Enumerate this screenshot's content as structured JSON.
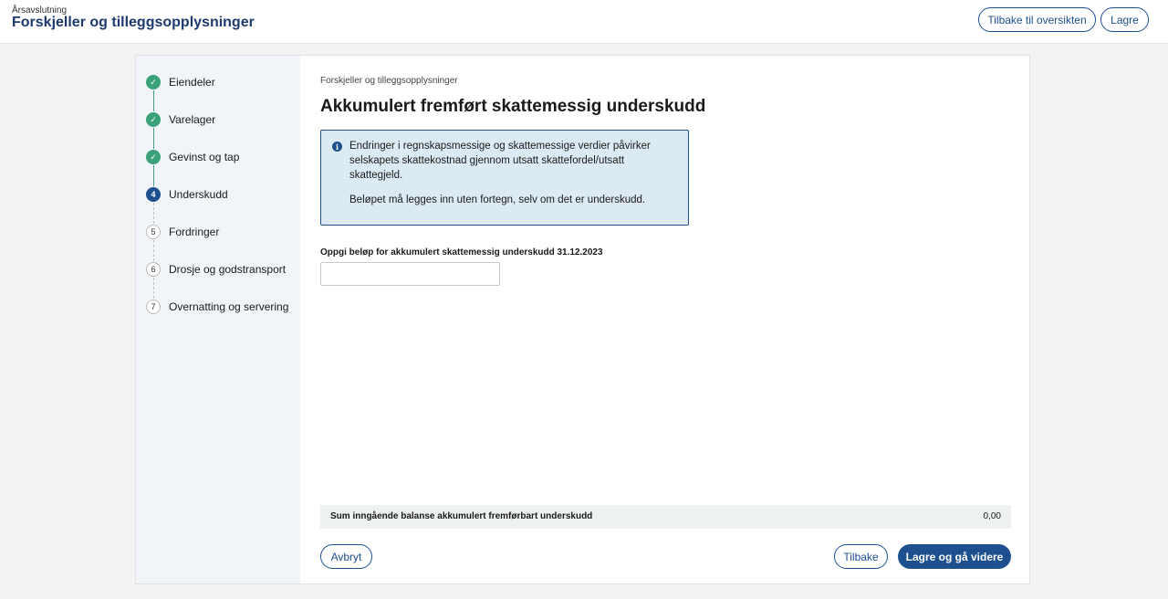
{
  "header": {
    "breadcrumb": "Årsavslutning",
    "title": "Forskjeller og tilleggsopplysninger",
    "back_to_overview_label": "Tilbake til oversikten",
    "save_label": "Lagre"
  },
  "steps": [
    {
      "number": "1",
      "label": "Eiendeler",
      "status": "done"
    },
    {
      "number": "2",
      "label": "Varelager",
      "status": "done"
    },
    {
      "number": "3",
      "label": "Gevinst og tap",
      "status": "done"
    },
    {
      "number": "4",
      "label": "Underskudd",
      "status": "active"
    },
    {
      "number": "5",
      "label": "Fordringer",
      "status": "todo"
    },
    {
      "number": "6",
      "label": "Drosje og godstransport",
      "status": "todo"
    },
    {
      "number": "7",
      "label": "Overnatting og servering",
      "status": "todo"
    }
  ],
  "main": {
    "breadcrumb": "Forskjeller og tilleggsopplysninger",
    "title": "Akkumulert fremført skattemessig underskudd",
    "info": {
      "icon": "info-icon",
      "paragraph1": "Endringer i regnskapsmessige og skattemessige verdier påvirker selskapets skattekostnad gjennom utsatt skattefordel/utsatt skattegjeld.",
      "paragraph2": "Beløpet må legges inn uten fortegn, selv om det er underskudd."
    },
    "field_label": "Oppgi beløp for akkumulert skattemessig underskudd 31.12.2023",
    "field_value": "",
    "sum_label": "Sum inngående balanse akkumulert fremførbart underskudd",
    "sum_value": "0,00",
    "cancel_label": "Avbryt",
    "back_label": "Tilbake",
    "save_continue_label": "Lagre og gå videre"
  },
  "colors": {
    "primary": "#1e4f8f",
    "done": "#3aa17b",
    "info_bg": "#dceaf3"
  }
}
